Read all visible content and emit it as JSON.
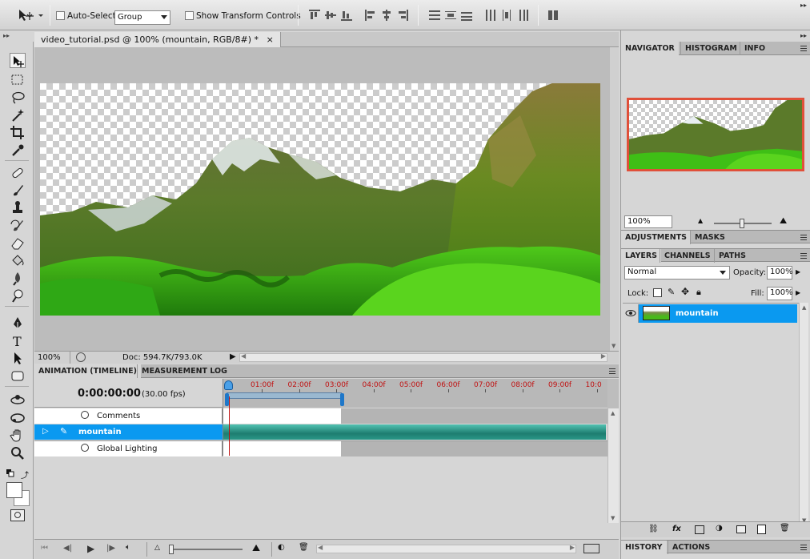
{
  "options_bar": {
    "auto_select_label": "Auto-Select:",
    "auto_select_value": "Group",
    "show_transform_label": "Show Transform Controls"
  },
  "document": {
    "tab_title": "video_tutorial.psd @ 100% (mountain, RGB/8#) *",
    "zoom": "100%",
    "doc_size": "Doc: 594.7K/793.0K"
  },
  "timeline": {
    "tabs": [
      "ANIMATION (TIMELINE)",
      "MEASUREMENT LOG"
    ],
    "current_time": "0:00:00:00",
    "fps": "(30.00 fps)",
    "ruler": [
      "01:00f",
      "02:00f",
      "03:00f",
      "04:00f",
      "05:00f",
      "06:00f",
      "07:00f",
      "08:00f",
      "09:00f",
      "10:0"
    ],
    "tracks": [
      {
        "label": "Comments"
      },
      {
        "label": "mountain"
      },
      {
        "label": "Global Lighting"
      }
    ]
  },
  "navigator": {
    "tabs": [
      "NAVIGATOR",
      "HISTOGRAM",
      "INFO"
    ],
    "zoom": "100%"
  },
  "adjustments": {
    "tabs": [
      "ADJUSTMENTS",
      "MASKS"
    ]
  },
  "layers_panel": {
    "tabs": [
      "LAYERS",
      "CHANNELS",
      "PATHS"
    ],
    "blend_mode": "Normal",
    "opacity_label": "Opacity:",
    "opacity_value": "100%",
    "lock_label": "Lock:",
    "fill_label": "Fill:",
    "fill_value": "100%",
    "layers": [
      {
        "name": "mountain"
      }
    ]
  },
  "history": {
    "tabs": [
      "HISTORY",
      "ACTIONS"
    ]
  },
  "colors": {
    "selection": "#0a99f0",
    "playhead": "#c01010",
    "track": "#2a8f84",
    "ruler_text": "#c01010"
  }
}
